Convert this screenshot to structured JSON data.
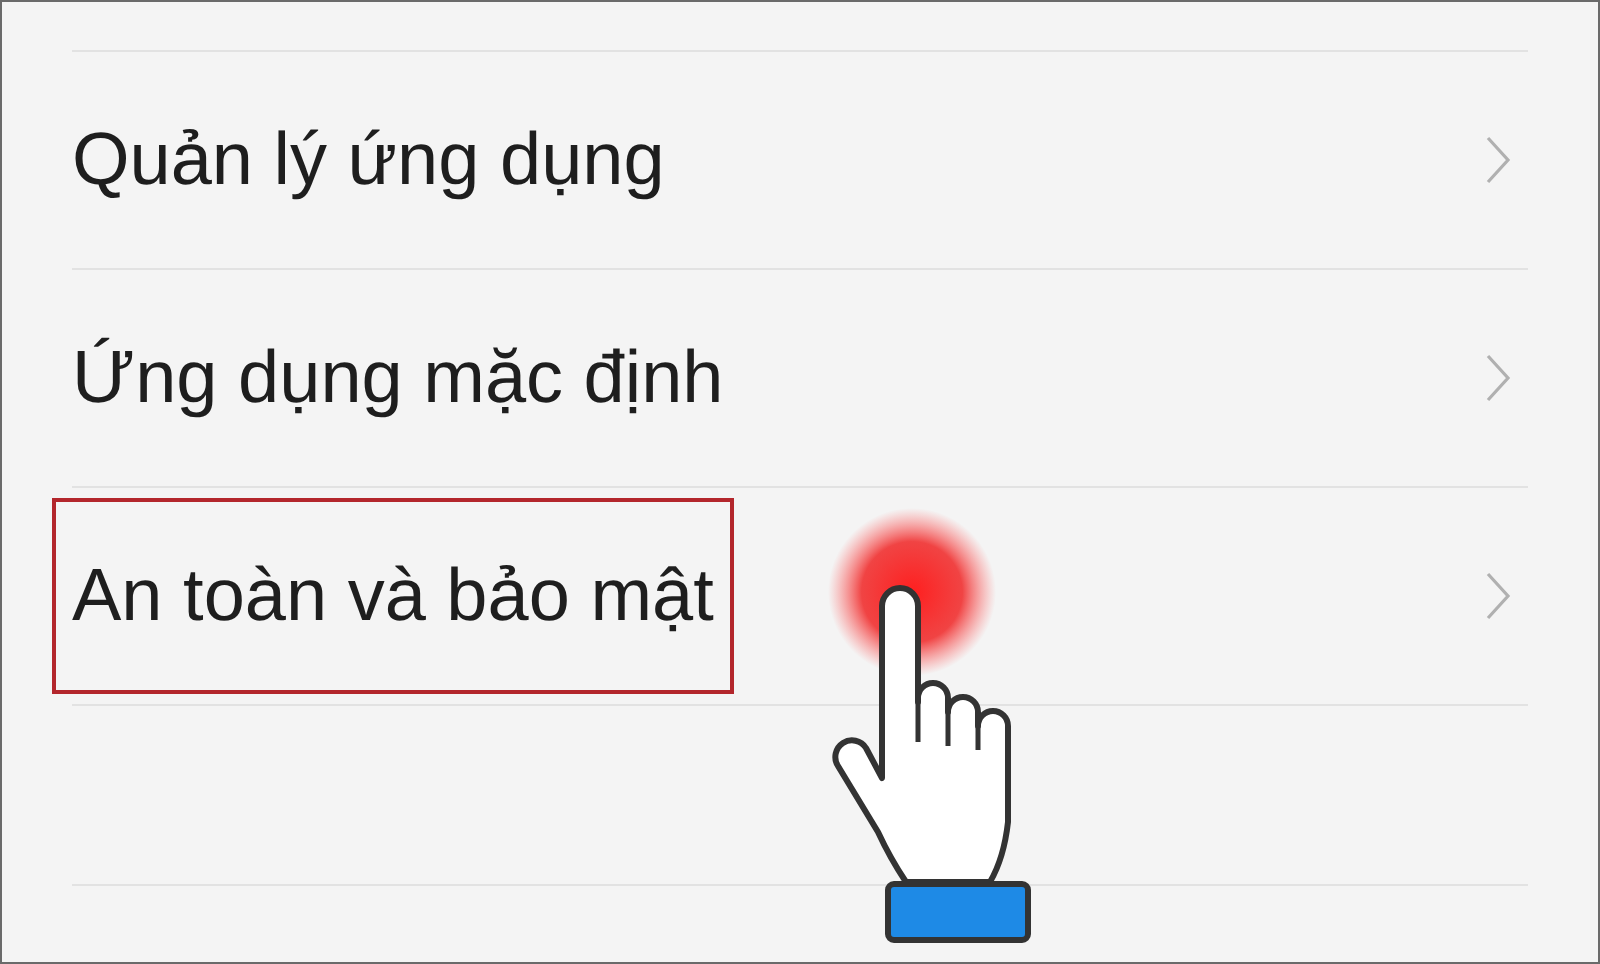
{
  "settings_items": [
    {
      "label": "Quản lý ứng dụng",
      "highlighted": false
    },
    {
      "label": "Ứng dụng mặc định",
      "highlighted": false
    },
    {
      "label": "An toàn và bảo mật",
      "highlighted": true
    }
  ]
}
